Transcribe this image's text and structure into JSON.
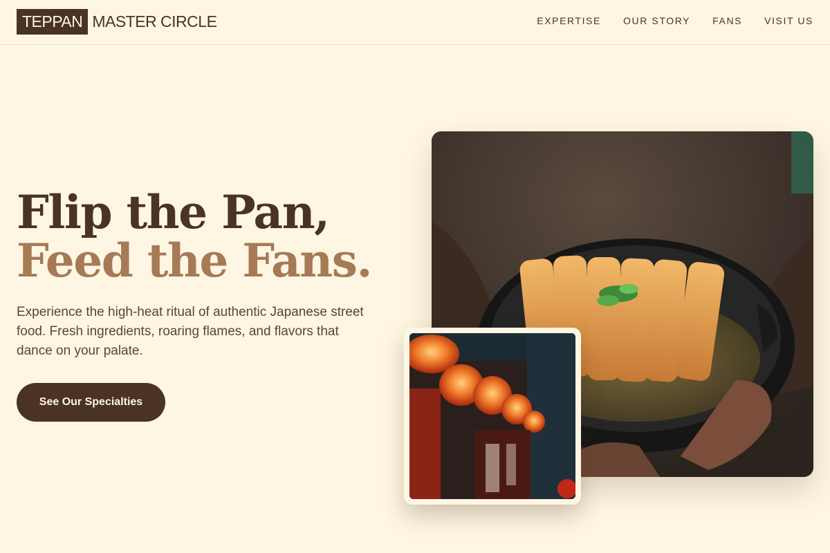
{
  "brand": {
    "boxed": "TEPPAN",
    "rest": "MASTER CIRCLE"
  },
  "nav": {
    "items": [
      "EXPERTISE",
      "OUR STORY",
      "FANS",
      "VISIT US"
    ]
  },
  "hero": {
    "headline_line1": "Flip the Pan,",
    "headline_line2": "Feed the Fans.",
    "subtext": "Experience the high-heat ritual of authentic Japanese street food. Fresh ingredients, roaring flames, and flavors that dance on your palate.",
    "cta_label": "See Our Specialties"
  },
  "images": {
    "main": {
      "icon": "katsu-bowl-photo"
    },
    "inset": {
      "icon": "lantern-street-photo"
    }
  },
  "colors": {
    "background": "#fef6e2",
    "primary": "#4a3322",
    "accent": "#a57a55"
  }
}
